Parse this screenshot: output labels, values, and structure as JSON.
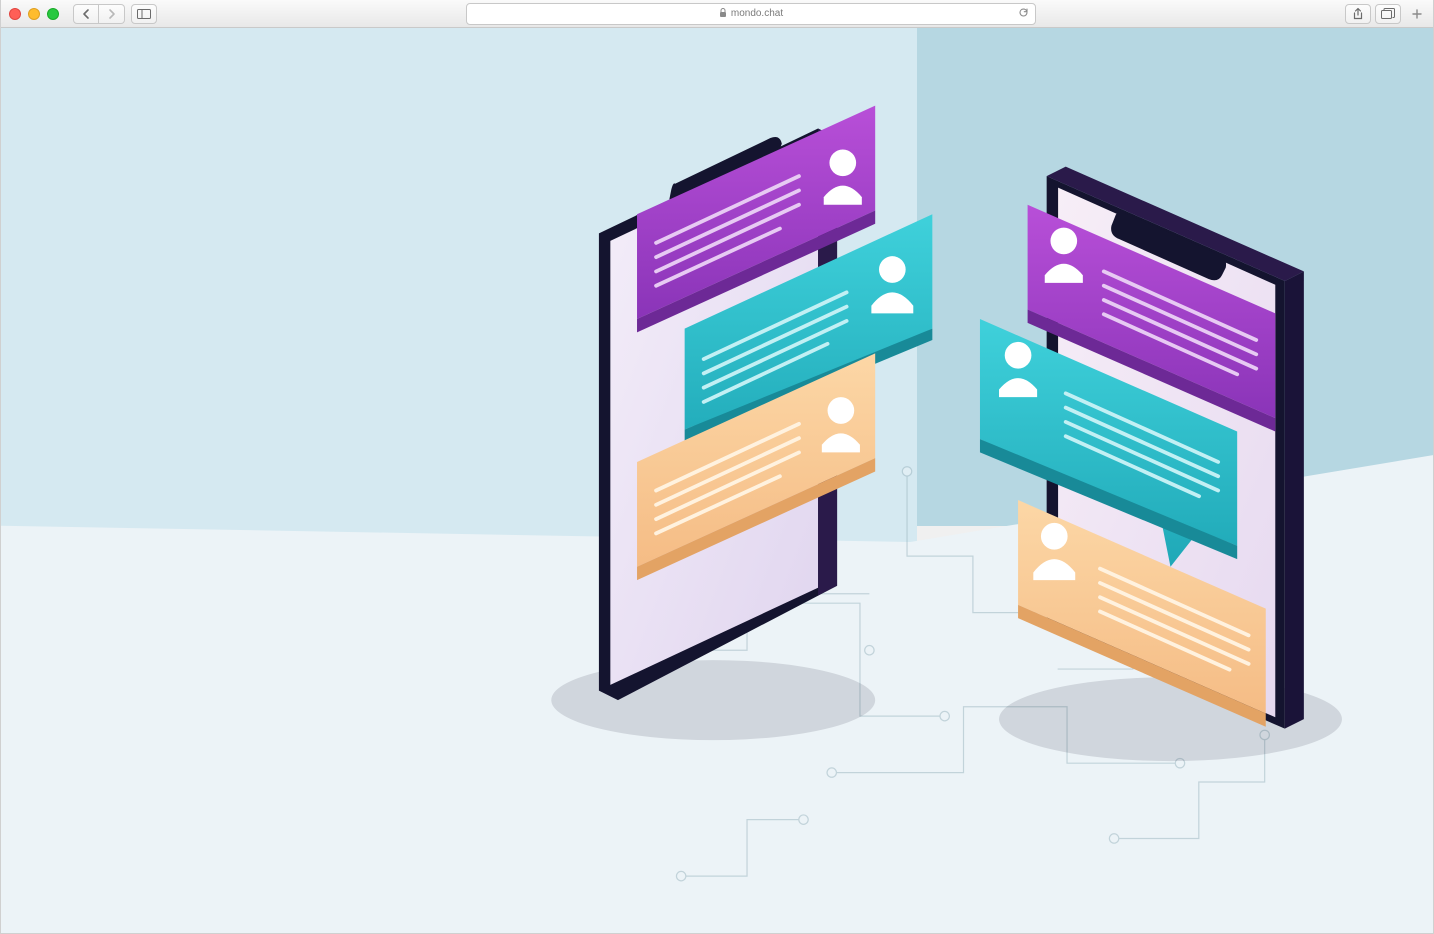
{
  "browser": {
    "url": "mondo.chat",
    "secure_icon": "lock-icon",
    "refresh_icon": "refresh-icon",
    "back_icon": "chevron-left-icon",
    "forward_icon": "chevron-right-icon",
    "sidebar_icon": "sidebar-toggle-icon",
    "share_icon": "share-icon",
    "tabs_icon": "tabs-icon",
    "new_tab_icon": "plus-icon"
  },
  "illustration": {
    "description": "Isometric illustration of two smartphones with floating chat message bubbles",
    "bubble_colors": {
      "purple": "#9b40c9",
      "teal": "#2fb9c6",
      "orange": "#f9c88f"
    }
  }
}
